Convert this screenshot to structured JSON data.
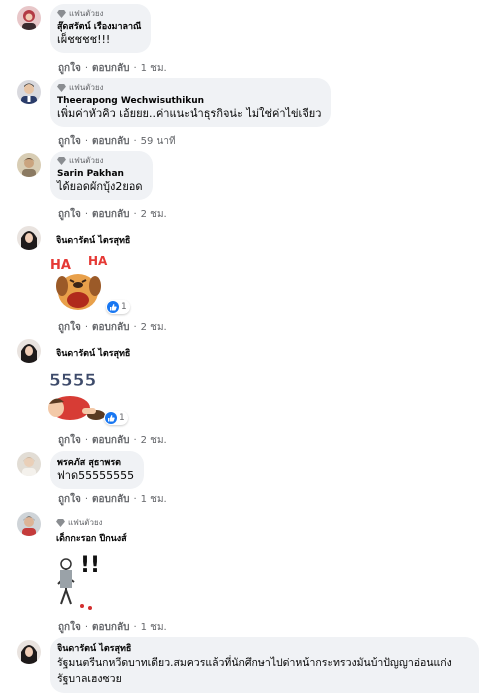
{
  "badge_label": "แฟนตัวยง",
  "comments": [
    {
      "author": "สุ๊ดสรัตน์ เรืองมาลาณี",
      "text": "เผ็ชชชช!!!",
      "like": "ถูกใจ",
      "reply": "ตอบกลับ",
      "time": "1 ชม."
    },
    {
      "author": "Theerapong Wechwisuthikun",
      "text": "เพิ่มค่าหัวคิว เอ้ยยย..ค่าแนะนำธุรกิจน่ะ ไม่ใช่ค่าไข่เจียว",
      "like": "ถูกใจ",
      "reply": "ตอบกลับ",
      "time": "59 นาที"
    },
    {
      "author": "Sarin Pakhan",
      "text": "ได้ยอดผักบุ้ง2ยอด",
      "like": "ถูกใจ",
      "reply": "ตอบกลับ",
      "time": "2 ชม."
    },
    {
      "author": "จินดารัตน์ ไตรสุทธิ",
      "sticker_text": "HA HA",
      "reaction_count": "1",
      "like": "ถูกใจ",
      "reply": "ตอบกลับ",
      "time": "2 ชม."
    },
    {
      "author": "จินดารัตน์ ไตรสุทธิ",
      "sticker_text": "5555",
      "reaction_count": "1",
      "like": "ถูกใจ",
      "reply": "ตอบกลับ",
      "time": "2 ชม."
    },
    {
      "author": "พรคภัส สุธาพรต",
      "text": "ฟาด55555555",
      "like": "ถูกใจ",
      "reply": "ตอบกลับ",
      "time": "1 ชม."
    },
    {
      "author": "เด็กกะรอก ปีกนงส์",
      "sticker_text": "!!",
      "like": "ถูกใจ",
      "reply": "ตอบกลับ",
      "time": "1 ชม."
    },
    {
      "author": "จินดารัตน์ ไตรสุทธิ",
      "text": "รัฐมนตรีนกหวีดบาทเดียว.สมควรแล้วที่นักศึกษาไปด่าหน้ากระทรวงมันบ้าปัญญาอ่อนแก่ง รัฐบาลเฮงซวย"
    }
  ],
  "colors": {
    "bubble": "#f0f2f5",
    "meta": "#65676b",
    "like_blue": "#1877f2"
  }
}
